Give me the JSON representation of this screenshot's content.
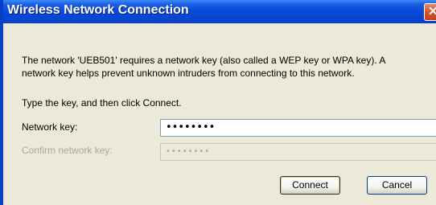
{
  "window": {
    "title": "Wireless Network Connection",
    "close_glyph": "✕"
  },
  "dialog": {
    "message_line1": "The network 'UEB501' requires a network key (also called a WEP key or WPA key). A",
    "message_line2": "network key helps prevent unknown intruders from connecting to this network.",
    "instruction": "Type the key, and then click Connect.",
    "network_key_label": "Network key:",
    "network_key_value": "••••••••",
    "confirm_key_label": "Confirm network key:",
    "confirm_key_value": "••••••••",
    "confirm_enabled": false
  },
  "buttons": {
    "connect": "Connect",
    "cancel": "Cancel"
  },
  "colors": {
    "titlebar": "#0a4ad8",
    "dialog_background": "#ece9d8",
    "disabled_text": "#aca899"
  }
}
